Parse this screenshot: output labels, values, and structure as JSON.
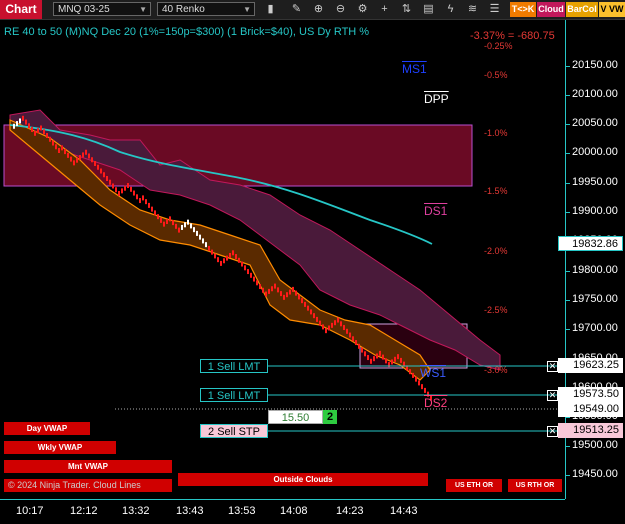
{
  "toolbar": {
    "chart_tab": "Chart",
    "instrument": "MNQ 03-25",
    "bar_type": "40 Renko",
    "btn_tk": "T<>K",
    "btn_cloud": "Cloud",
    "btn_barcol": "BarCol",
    "btn_vw": "V VW"
  },
  "header": {
    "title": "RE 40 to 50 (M)NQ Dec 20 (1%=150p=$300) (1 Brick=$40), US Dy RTH %",
    "pnl": "-3.37% = -680.75"
  },
  "pct_labels": [
    "-0.25%",
    "-0.5%",
    "-1.0%",
    "-1.5%",
    "-2.0%",
    "-2.5%",
    "-3.0%"
  ],
  "levels": {
    "ms1": "MS1",
    "dpp": "DPP",
    "ds1": "DS1",
    "ws1": "WS1",
    "ds2": "DS2"
  },
  "price_axis": [
    "20150.00",
    "20100.00",
    "20050.00",
    "20000.00",
    "19950.00",
    "19900.00",
    "19850.00",
    "19800.00",
    "19750.00",
    "19700.00",
    "19650.00",
    "19600.00",
    "19550.00",
    "19500.00",
    "19450.00"
  ],
  "price_flags": {
    "cyan_line": "19832.86",
    "order1": "19623.25",
    "order2": "19573.50",
    "last": "19549.00",
    "stop": "19513.25"
  },
  "orders": [
    {
      "label": "1 Sell LMT",
      "price": "19623.25"
    },
    {
      "label": "1 Sell LMT",
      "price": "19573.50"
    },
    {
      "label": "2 Sell STP",
      "price": "19513.25"
    }
  ],
  "order_entry": {
    "value": "15.50",
    "qty": "2"
  },
  "vwap_buttons": [
    "Day VWAP",
    "Wkly VWAP",
    "Mnt VWAP"
  ],
  "bottom_buttons": {
    "outside": "Outside Clouds",
    "eth": "US ETH OR",
    "rth": "US RTH OR"
  },
  "copyright": "© 2024 Ninja Trader. Cloud Lines",
  "time_axis": [
    "10:17",
    "12:12",
    "13:32",
    "13:43",
    "13:53",
    "14:08",
    "14:23",
    "14:43"
  ],
  "colors": {
    "accent": "#26c6c6",
    "brick_down": "#ff1a1a",
    "brick_up": "#ffffff",
    "cloud_magenta": "#c2185b",
    "cloud_orange": "#ff8c00",
    "zone": "#7a0a2a"
  }
}
